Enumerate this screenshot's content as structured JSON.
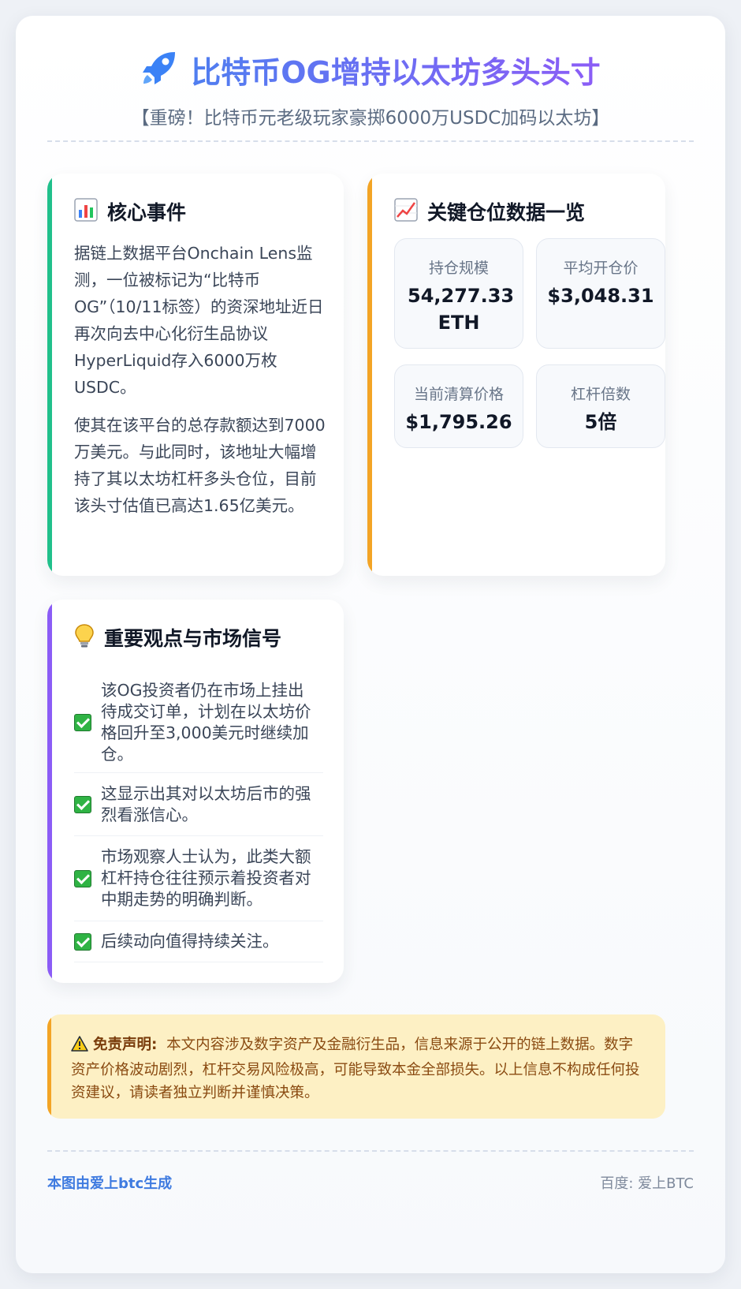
{
  "header": {
    "title": "比特币OG增持以太坊多头头寸",
    "subtitle": "【重磅！比特币元老级玩家豪掷6000万USDC加码以太坊】",
    "icon": "rocket-icon"
  },
  "core_event": {
    "icon": "bar-chart-icon",
    "title": "核心事件",
    "paragraphs": [
      "据链上数据平台Onchain Lens监测，一位被标记为“比特币OG”（10/11标签）的资深地址近日再次向去中心化衍生品协议HyperLiquid存入6000万枚USDC。",
      "使其在该平台的总存款额达到7000万美元。与此同时，该地址大幅增持了其以太坊杠杆多头仓位，目前该头寸估值已高达1.65亿美元。"
    ]
  },
  "positions": {
    "icon": "trending-up-icon",
    "title": "关键仓位数据一览",
    "stats": [
      {
        "label": "持仓规模",
        "value": "54,277.33 ETH"
      },
      {
        "label": "平均开仓价",
        "value": "$3,048.31"
      },
      {
        "label": "当前清算价格",
        "value": "$1,795.26"
      },
      {
        "label": "杠杆倍数",
        "value": "5倍"
      }
    ]
  },
  "viewpoints": {
    "icon": "lightbulb-icon",
    "title": "重要观点与市场信号",
    "items": [
      "该OG投资者仍在市场上挂出待成交订单，计划在以太坊价格回升至3,000美元时继续加仓。",
      "这显示出其对以太坊后市的强烈看涨信心。",
      "市场观察人士认为，此类大额杠杆持仓往往预示着投资者对中期走势的明确判断。",
      "后续动向值得持续关注。"
    ]
  },
  "disclaimer": {
    "icon": "warning-icon",
    "label": "免责声明:",
    "text": "本文内容涉及数字资产及金融衍生品，信息来源于公开的链上数据。数字资产价格波动剧烈，杠杆交易风险极高，可能导致本金全部损失。以上信息不构成任何投资建议，请读者独立判断并谨慎决策。"
  },
  "footer": {
    "left": "本图由爱上btc生成",
    "right": "百度: 爱上BTC"
  },
  "colors": {
    "accent_blue": "#4f7ef0",
    "accent_purple": "#8b5cf6",
    "green": "#20c08b",
    "orange": "#f3a425",
    "disclaimer_bg": "#fdf0c4"
  }
}
